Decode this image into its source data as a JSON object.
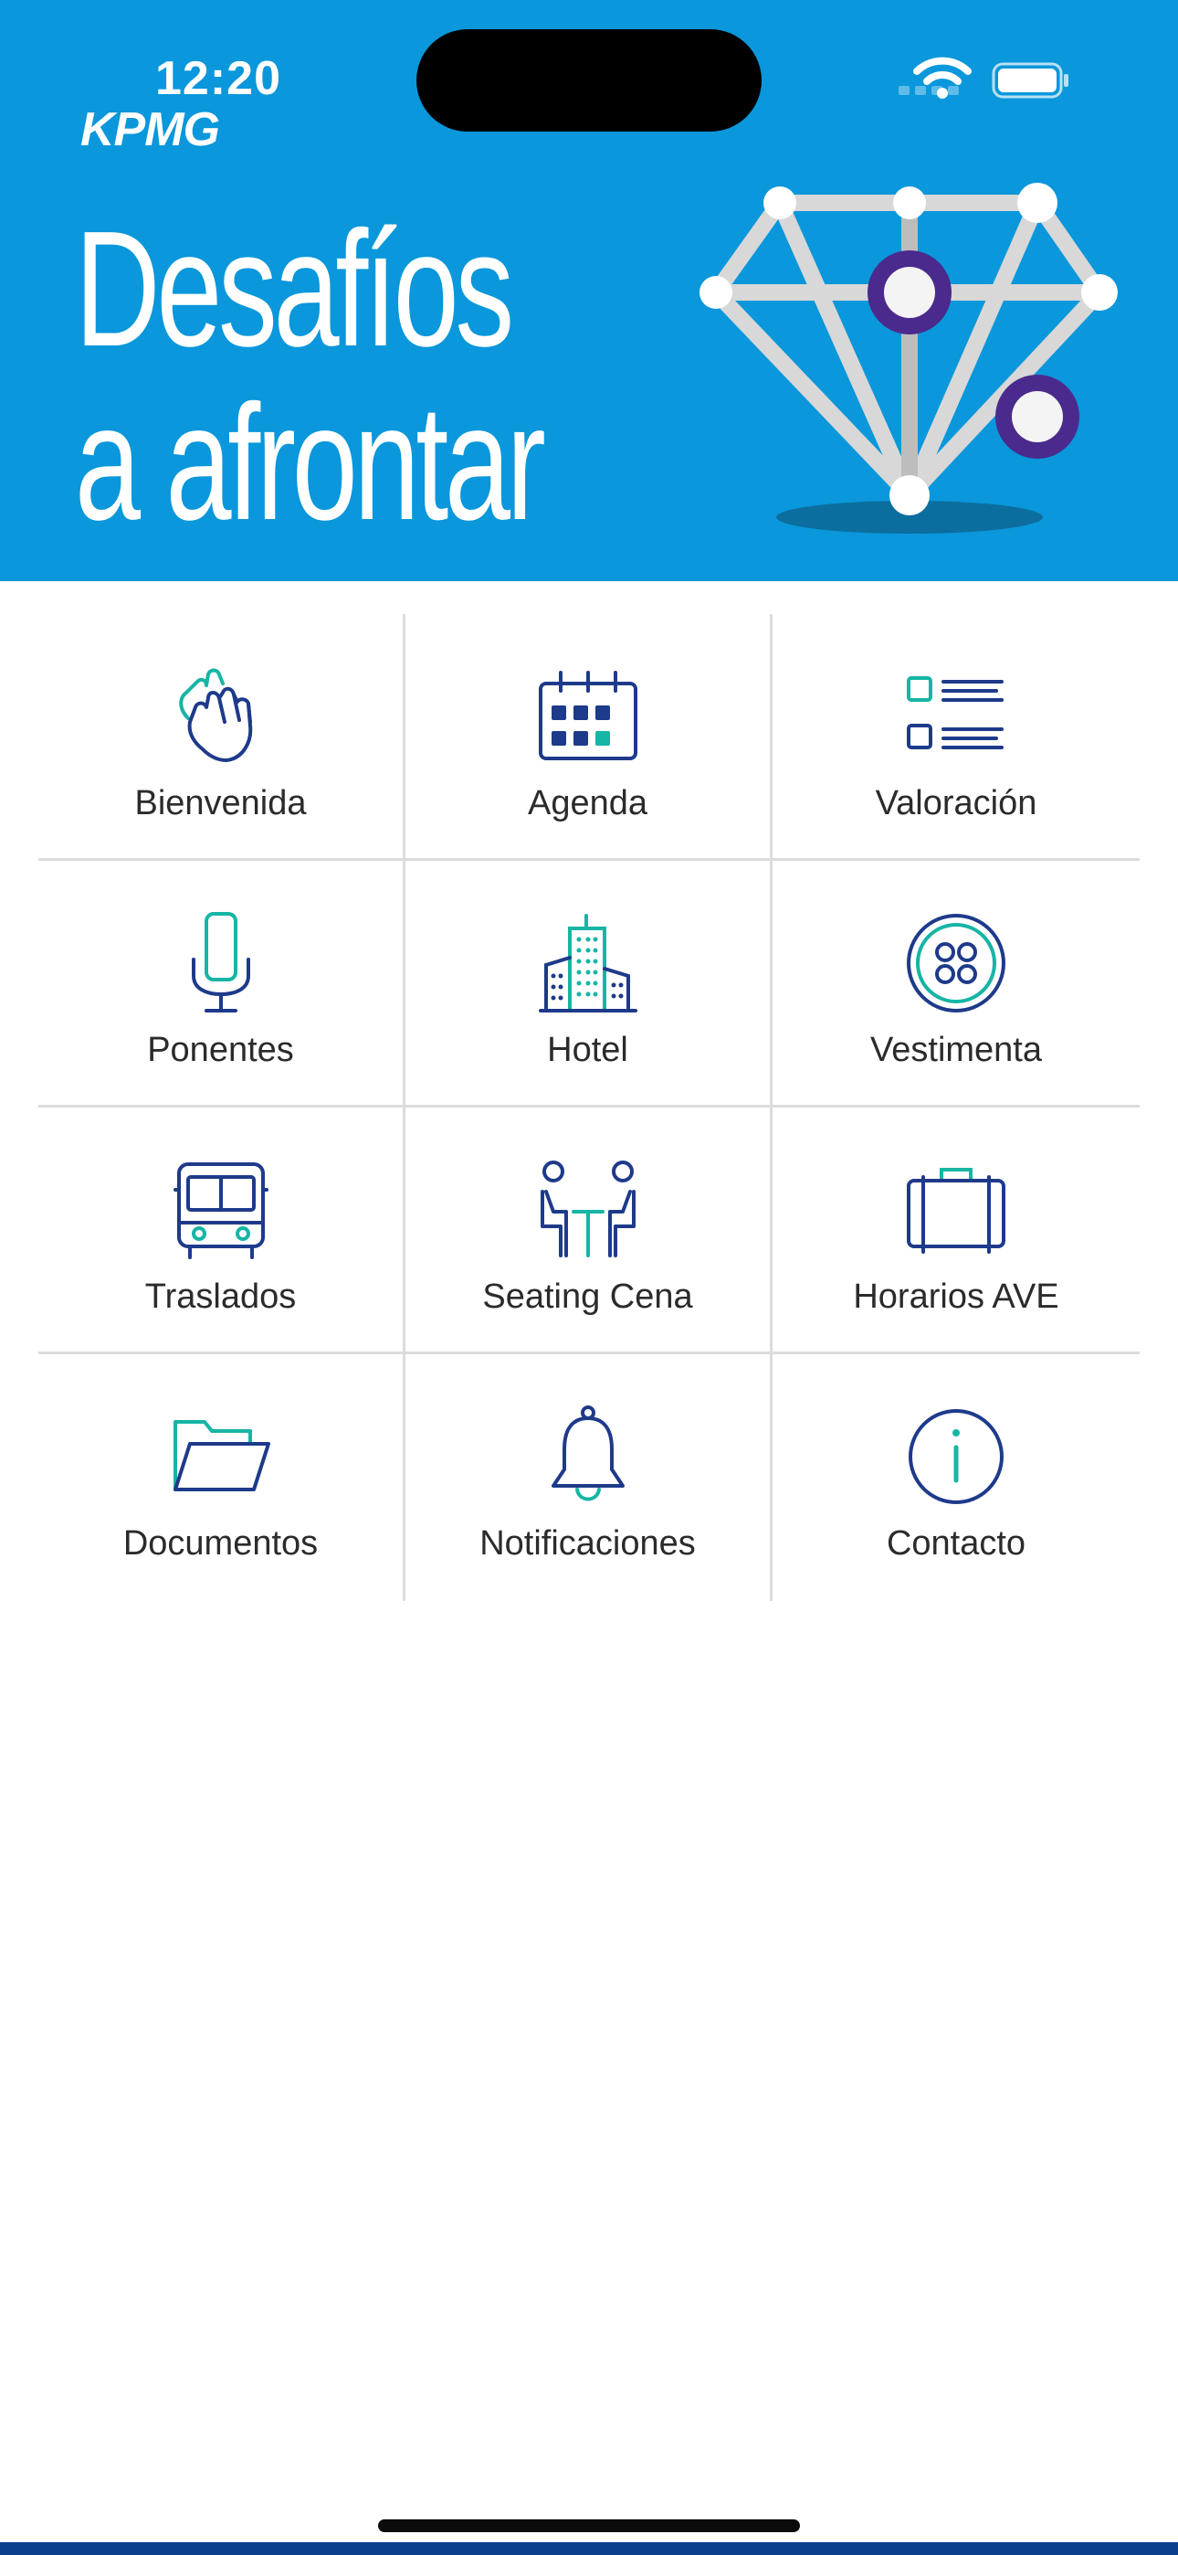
{
  "status_bar": {
    "time": "12:20"
  },
  "header": {
    "logo": "KPMG",
    "title_line1": "Desafíos",
    "title_line2": "a afrontar",
    "background_color": "#0A97DB"
  },
  "menu": {
    "items": [
      {
        "label": "Bienvenida",
        "icon": "clapping-hands-icon"
      },
      {
        "label": "Agenda",
        "icon": "calendar-icon"
      },
      {
        "label": "Valoración",
        "icon": "checklist-icon"
      },
      {
        "label": "Ponentes",
        "icon": "microphone-icon"
      },
      {
        "label": "Hotel",
        "icon": "building-icon"
      },
      {
        "label": "Vestimenta",
        "icon": "button-icon"
      },
      {
        "label": "Traslados",
        "icon": "bus-icon"
      },
      {
        "label": "Seating Cena",
        "icon": "dinner-seating-icon"
      },
      {
        "label": "Horarios AVE",
        "icon": "suitcase-icon"
      },
      {
        "label": "Documentos",
        "icon": "folder-icon"
      },
      {
        "label": "Notificaciones",
        "icon": "bell-icon"
      },
      {
        "label": "Contacto",
        "icon": "info-icon"
      }
    ],
    "icon_primary_color": "#1E3A8A",
    "icon_accent_color": "#16B5A5"
  }
}
